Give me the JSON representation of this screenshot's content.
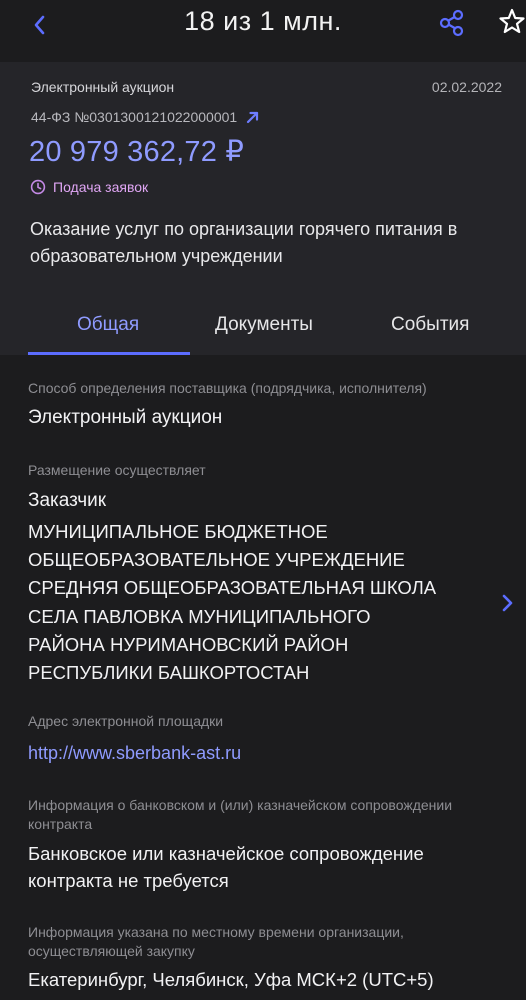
{
  "header": {
    "title": "18 из 1 млн.",
    "icons": {
      "back": "chevron-left-icon",
      "share": "share-icon",
      "favorite": "star-outline-icon"
    },
    "accent": "#5c6dff"
  },
  "card": {
    "procedure_type": "Электронный аукцион",
    "date": "02.02.2022",
    "number": "44-ФЗ №0301300121022000001",
    "price": "20 979 362,72 ₽",
    "status": "Подача заявок",
    "status_color": "#e0a6f4",
    "description": "Оказание услуг по организации горячего питания в образовательном учреждении"
  },
  "tabs": [
    {
      "label": "Общая",
      "active": true
    },
    {
      "label": "Документы",
      "active": false
    },
    {
      "label": "События",
      "active": false
    }
  ],
  "fields": {
    "method": {
      "label": "Способ определения поставщика (подрядчика, исполнителя)",
      "value": "Электронный аукцион"
    },
    "placement": {
      "label": "Размещение осуществляет",
      "role": "Заказчик",
      "organization": [
        "МУНИЦИПАЛЬНОЕ БЮДЖЕТНОЕ",
        "ОБЩЕОБРАЗОВАТЕЛЬНОЕ УЧРЕЖДЕНИЕ",
        "СРЕДНЯЯ ОБЩЕОБРАЗОВАТЕЛЬНАЯ ШКОЛА",
        "СЕЛА ПАВЛОВКА МУНИЦИПАЛЬНОГО",
        "РАЙОНА НУРИМАНОВСКИЙ РАЙОН",
        "РЕСПУБЛИКИ  БАШКОРТОСТАН"
      ]
    },
    "platform": {
      "label": "Адрес электронной площадки",
      "value": "http://www.sberbank-ast.ru"
    },
    "banking": {
      "label": "Информация о банковском и (или) казначейском сопровождении контракта",
      "value": "Банковское или казначейское сопровождение контракта не требуется"
    },
    "timezone": {
      "label": "Информация указана по местному времени организации, осуществляющей закупку",
      "value": "Екатеринбург, Челябинск, Уфа МСК+2 (UTC+5)"
    }
  }
}
